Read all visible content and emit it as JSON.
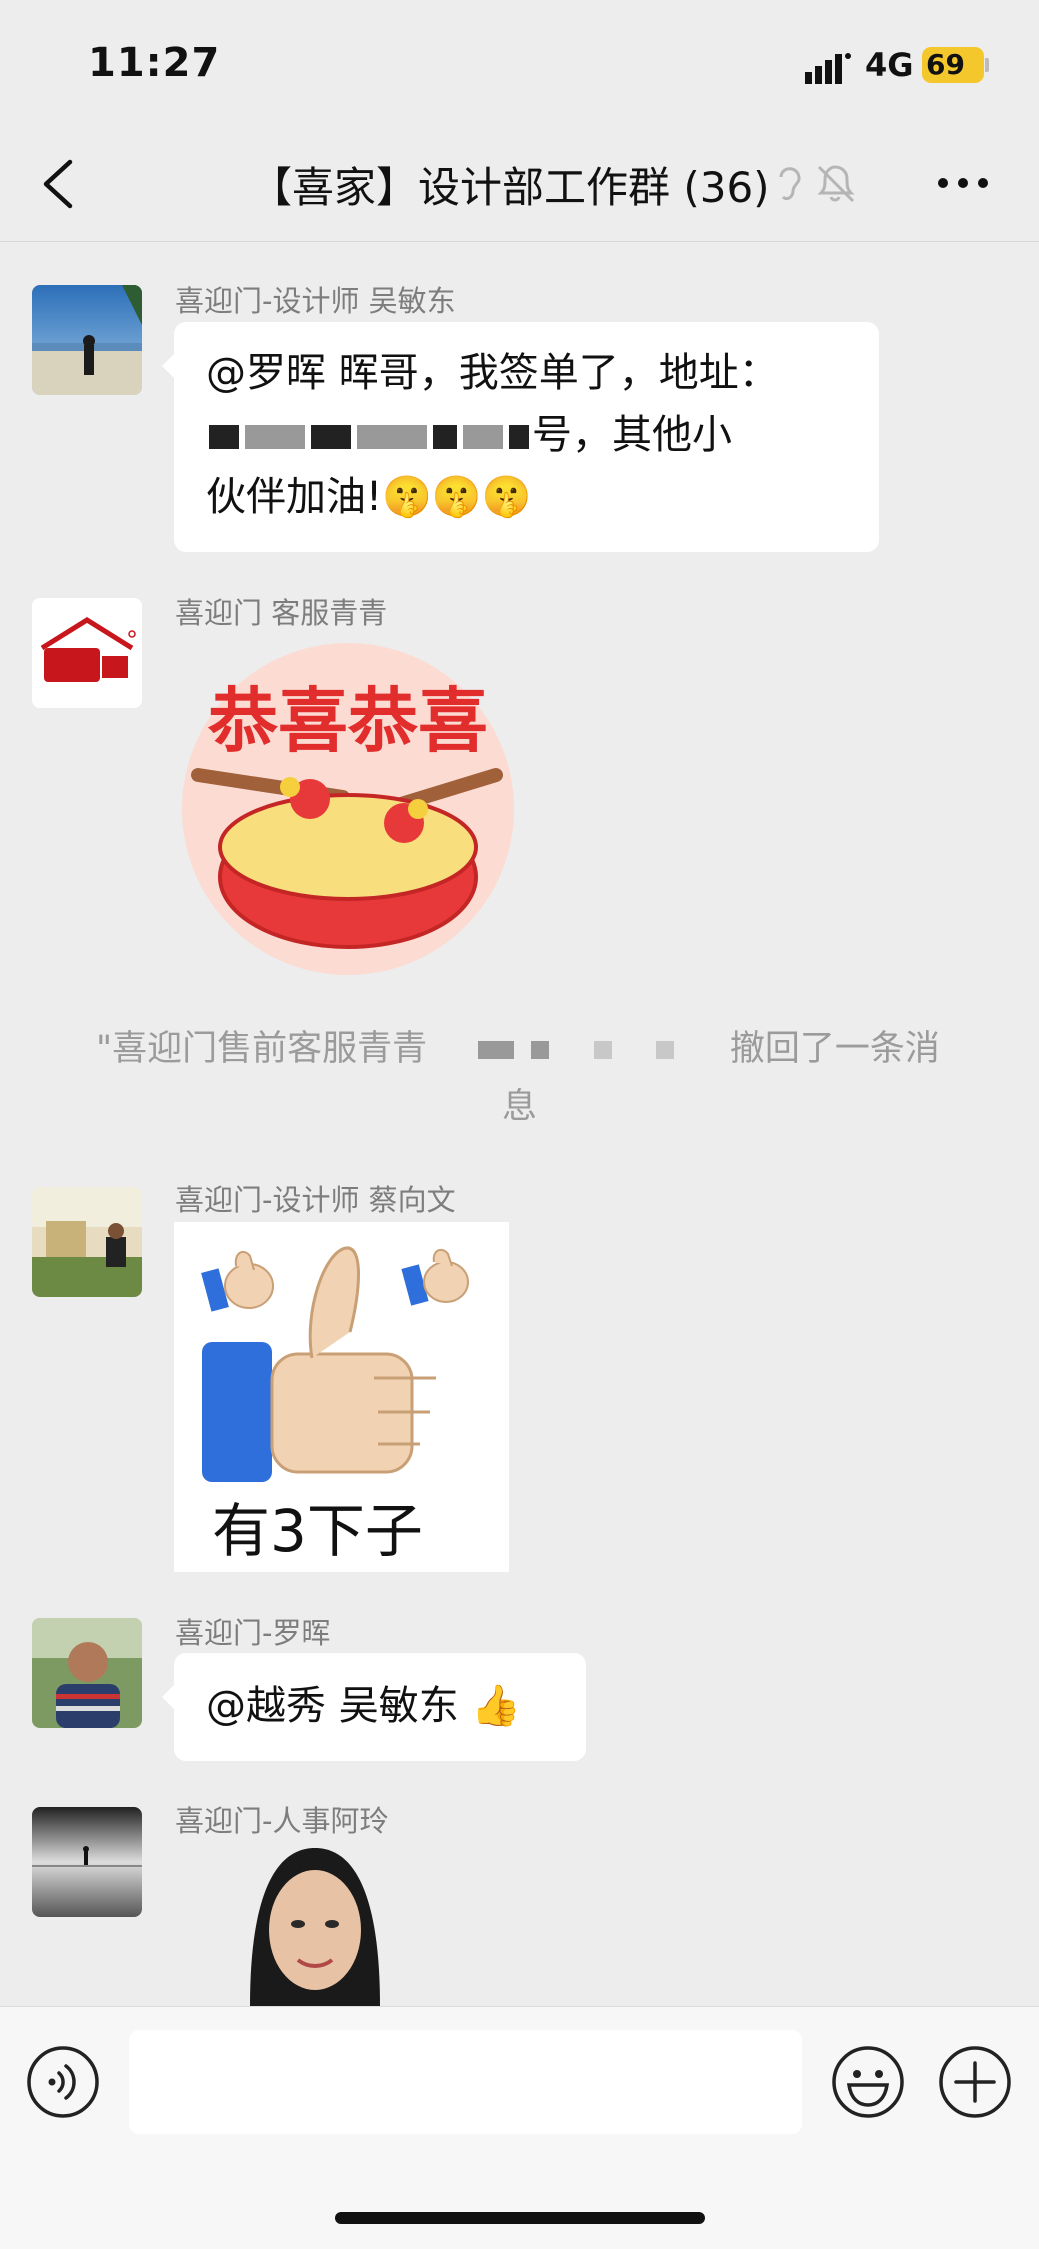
{
  "status_bar": {
    "time": "11:27",
    "network": "4G",
    "battery": "69"
  },
  "nav": {
    "title": "【喜家】设计部工作群 (36)"
  },
  "messages": [
    {
      "sender": "喜迎门-设计师 吴敏东",
      "line1": "@罗晖 晖哥，我签单了，地址：",
      "line2_visible": "号，其他小",
      "line3": "伙伴加油!",
      "emoji": "🤫🤫🤫"
    },
    {
      "sender": "喜迎门 客服青青",
      "sticker_text": "恭喜恭喜"
    },
    {
      "system_part1": "\"喜迎门售前客服青青",
      "system_part2": "撤回了一条消",
      "system_part3": "息"
    },
    {
      "sender": "喜迎门-设计师 蔡向文",
      "sticker_text": "有3下子"
    },
    {
      "sender": "喜迎门-罗晖",
      "text": "@越秀 吴敏东 👍"
    },
    {
      "sender": "喜迎门-人事阿玲"
    }
  ],
  "icons": {
    "back": "chevron-left-icon",
    "ear": "ear-icon",
    "mute": "bell-off-icon",
    "more": "more-icon",
    "voice": "voice-icon",
    "emoji": "emoji-icon",
    "plus": "plus-icon"
  }
}
